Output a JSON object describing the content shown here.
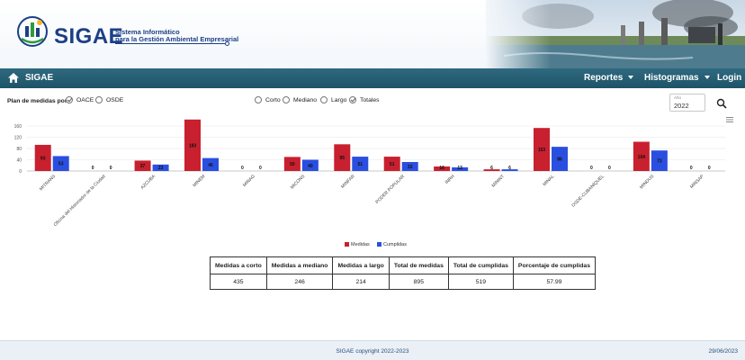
{
  "app": {
    "logo_text": "SIGAE",
    "logo_subtitle_1": "Sistema Informático",
    "logo_subtitle_2": "para la Gestión Ambiental Empresarial"
  },
  "navbar": {
    "brand": "SIGAE",
    "items": [
      {
        "label": "Reportes",
        "dropdown": true
      },
      {
        "label": "Histogramas",
        "dropdown": true
      },
      {
        "label": "Login",
        "dropdown": false
      }
    ]
  },
  "filters": {
    "plan_label": "Plan de medidas por:",
    "plan_options": [
      {
        "label": "OACE",
        "checked": true
      },
      {
        "label": "OSDE",
        "checked": false
      }
    ],
    "term_options": [
      {
        "label": "Corto",
        "checked": false
      },
      {
        "label": "Mediano",
        "checked": false
      },
      {
        "label": "Largo",
        "checked": false
      },
      {
        "label": "Totales",
        "checked": true
      }
    ],
    "year": {
      "label": "Año",
      "value": "2022"
    }
  },
  "chart_data": {
    "type": "bar",
    "categories": [
      "MITRANS",
      "Oficina del Historiador de la Ciudad",
      "AZCUBA",
      "MINEM",
      "MINAG",
      "MICONS",
      "MINFAR",
      "PODER POPULAR",
      "INRH",
      "MININT",
      "MINAL",
      "OSDE-CUBANÍQUEL",
      "MINDUS",
      "MINSAP"
    ],
    "series": [
      {
        "name": "Medidas",
        "values": [
          93,
          0,
          37,
          183,
          0,
          50,
          95,
          51,
          16,
          6,
          153,
          0,
          104,
          0
        ]
      },
      {
        "name": "Cumplidas",
        "values": [
          53,
          0,
          23,
          46,
          0,
          40,
          51,
          32,
          13,
          6,
          86,
          0,
          73,
          0
        ]
      }
    ],
    "y_ticks": [
      0,
      40,
      80,
      120,
      160
    ],
    "ylim": [
      0,
      160
    ],
    "colors": {
      "Medidas": "#c8202f",
      "Cumplidas": "#2a4fe0"
    },
    "legend_position": "bottom-center",
    "grid": true
  },
  "summary_table": {
    "headers": [
      "Medidas a corto",
      "Medidas a mediano",
      "Medidas a largo",
      "Total de medidas",
      "Total de cumplidas",
      "Porcentaje de cumplidas"
    ],
    "values": [
      "435",
      "246",
      "214",
      "895",
      "519",
      "57.99"
    ]
  },
  "footer": {
    "copyright": "SIGAE copyright 2022-2023",
    "date": "29/06/2023"
  },
  "icons": {
    "home": "home-icon",
    "search": "search-icon",
    "chart_menu": "hamburger-menu-icon"
  }
}
